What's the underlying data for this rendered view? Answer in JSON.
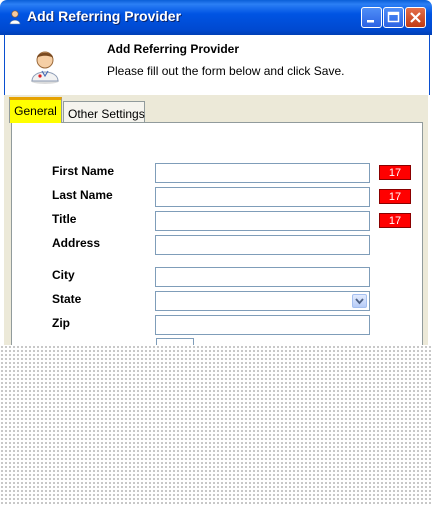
{
  "window": {
    "title": "Add Referring Provider",
    "icon": "user-icon"
  },
  "header": {
    "title": "Add Referring Provider",
    "subtitle": "Please fill out the form below and click Save.",
    "icon": "doctor-icon"
  },
  "tabs": [
    {
      "label": "General",
      "active": true
    },
    {
      "label": "Other Settings",
      "active": false
    }
  ],
  "form": {
    "fields": [
      {
        "label": "First Name",
        "value": "",
        "limit": "17"
      },
      {
        "label": "Last Name",
        "value": "",
        "limit": "17"
      },
      {
        "label": "Title",
        "value": "",
        "limit": "17"
      },
      {
        "label": "Address",
        "value": ""
      },
      {
        "label": "City",
        "value": ""
      },
      {
        "label": "State",
        "value": ""
      },
      {
        "label": "Zip",
        "value": ""
      }
    ]
  },
  "colors": {
    "titlebar": "#0054e3",
    "active_tab": "#ffff00",
    "badge": "#ff0000"
  }
}
